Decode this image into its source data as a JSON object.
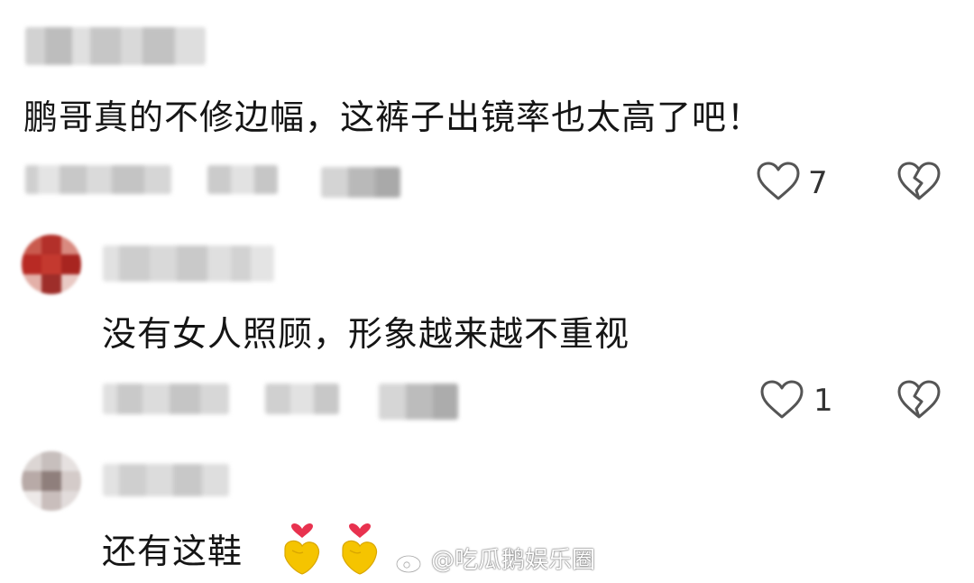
{
  "comments": [
    {
      "text": "鹏哥真的不修边幅，这裤子出镜率也太高了吧！",
      "likes": "7"
    },
    {
      "text": "没有女人照顾，形象越来越不重视",
      "likes": "1"
    },
    {
      "text": "还有这鞋"
    }
  ],
  "watermark": {
    "text": "@吃瓜鹅娱乐圈"
  },
  "colors": {
    "icon_stroke": "#555555",
    "emoji_heart": "#e8324f",
    "emoji_hand": "#f5c400"
  },
  "icons": {
    "like": "heart-outline-icon",
    "dislike": "broken-heart-icon",
    "emoji": "finger-heart-emoji",
    "watermark_logo": "weibo-logo-icon"
  }
}
